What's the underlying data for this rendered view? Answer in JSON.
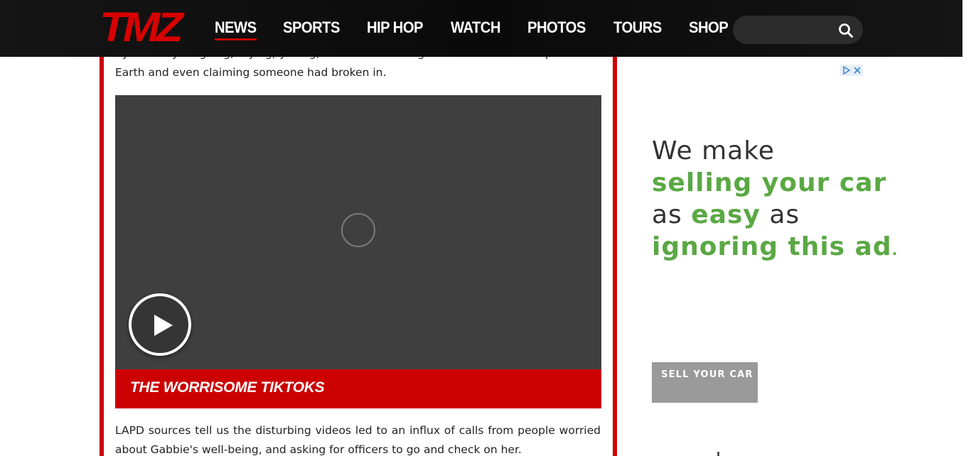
{
  "header": {
    "logo": "TMZ",
    "nav": [
      "NEWS",
      "SPORTS",
      "HIP HOP",
      "WATCH",
      "PHOTOS",
      "TOURS",
      "SHOP"
    ],
    "active_nav": "NEWS",
    "search_placeholder": "",
    "search_icon": "search-icon"
  },
  "article": {
    "para_top": "hysterically laughing, crying, yelling, at times declaring herself the smartest person on Earth and even claiming someone had broken in.",
    "video_caption": "THE WORRISOME TIKTOKS",
    "para_bottom": "LAPD sources tell us the disturbing videos led to an influx of calls from people worried about Gabbie's well-being, and asking for officers to go and check on her."
  },
  "ad": {
    "choices_icons": [
      "adchoices-icon",
      "close-icon"
    ],
    "line1": "We make",
    "line2": "selling your car",
    "line3_a": "as",
    "line3_b": "easy",
    "line3_c": "as",
    "line4": "ignoring this ad",
    "line4_dot": ".",
    "cta": "SELL YOUR CAR"
  },
  "colors": {
    "brand_red": "#cc0000",
    "header_bg": "#101010",
    "ad_green": "#5aa844",
    "player_bg": "#3f3f3f"
  }
}
